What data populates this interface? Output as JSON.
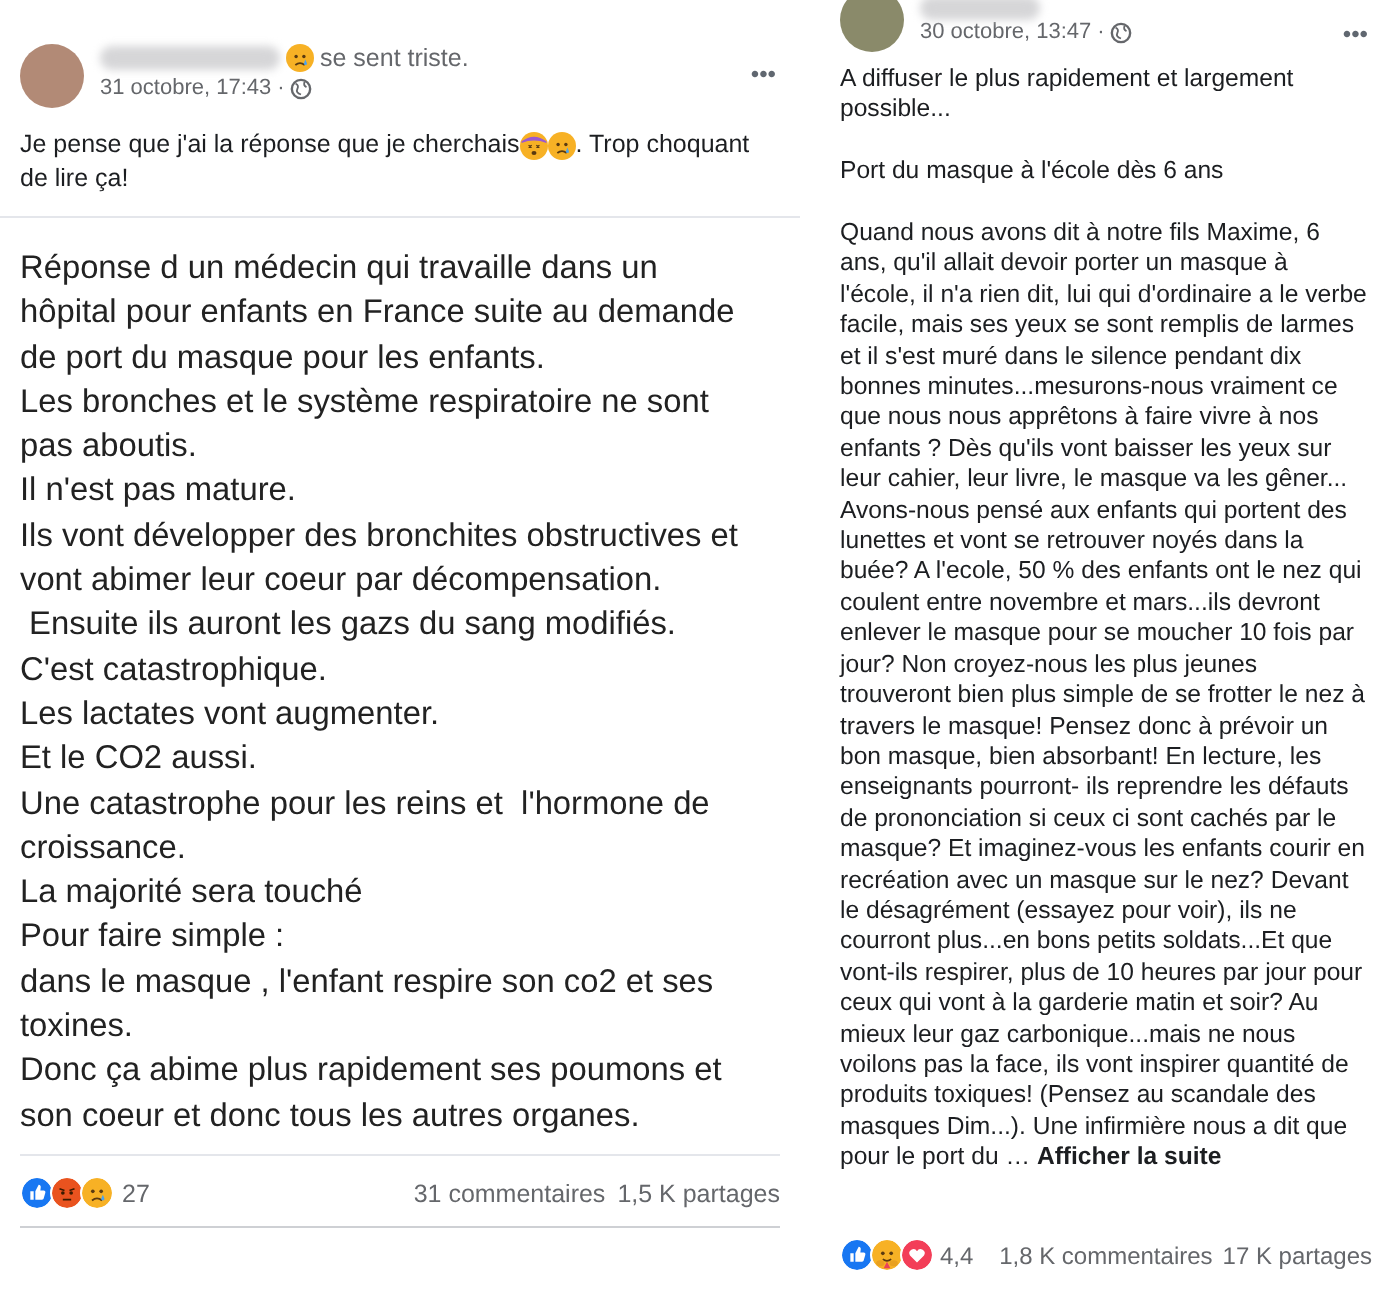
{
  "posts": [
    {
      "status": "se sent triste.",
      "time": "31 octobre, 17:43",
      "menu": "•••",
      "separator": "·",
      "caption_lines": [
        [
          "Je pense que j'ai la réponse que je cherchais",
          ". Trop choquant"
        ],
        [
          "de lire ça!"
        ]
      ],
      "image_lines": [
        "Réponse d un médecin qui travaille dans un",
        "hôpital pour enfants en France suite au demande",
        "de port du masque pour les enfants.",
        "Les bronches et le système respiratoire ne sont",
        "pas aboutis.",
        "Il n'est pas mature.",
        "Ils vont développer des bronchites obstructives et",
        "vont abimer leur coeur par décompensation.",
        " Ensuite ils auront les gazs du sang modifiés.",
        "C'est catastrophique.",
        "Les lactates vont augmenter.",
        "Et le CO2 aussi.",
        "Une catastrophe pour les reins et  l'hormone de",
        "croissance.",
        "La majorité sera touché",
        "Pour faire simple :",
        "dans le masque , l'enfant respire son co2 et ses",
        "toxines.",
        "Donc ça abime plus rapidement ses poumons et",
        "son coeur et donc tous les autres organes."
      ],
      "reactions": [
        {
          "kind": "like"
        },
        {
          "kind": "angry"
        },
        {
          "kind": "sad"
        }
      ],
      "reaction_count": "27",
      "comments": "31 commentaires",
      "shares": "1,5 K partages"
    },
    {
      "time": "30 octobre, 13:47",
      "separator": "·",
      "menu": "•••",
      "paragraphs": [
        "A diffuser le plus rapidement et largement possible...",
        "Port du masque à l'école dès 6 ans",
        "Quand nous avons dit à notre fils Maxime, 6 ans, qu'il allait devoir porter un masque à l'école, il n'a rien dit, lui qui d'ordinaire a le verbe facile, mais ses yeux se sont remplis de larmes et il s'est muré dans le silence pendant dix bonnes minutes...mesurons-nous vraiment ce que nous nous apprêtons à faire vivre à nos enfants ? Dès qu'ils vont baisser les yeux sur leur cahier, leur livre, le masque va les gêner... Avons-nous pensé aux enfants qui portent des lunettes et vont se retrouver noyés dans la buée? A l'ecole, 50 % des enfants ont le nez qui coulent entre novembre et mars...ils devront enlever le masque pour se moucher 10 fois par jour? Non croyez-nous les plus jeunes trouveront bien plus simple de se frotter le nez à travers le masque! Pensez donc à prévoir un bon masque, bien absorbant! En lecture, les enseignants pourront- ils reprendre les défauts de prononciation si ceux ci sont cachés par le masque? Et imaginez-vous les enfants courir en recréation avec un masque sur le nez? Devant le désagrément (essayez pour voir), ils ne courront plus...en bons petits soldats...Et que vont-ils respirer, plus de 10 heures par jour pour ceux qui vont à la garderie matin et soir? Au mieux leur gaz carbonique...mais ne nous voilons pas la face, ils vont inspirer quantité de produits toxiques! (Pensez au scandale des masques Dim...). Une infirmière nous a dit que pour le port du …"
      ],
      "see_more": "Afficher la suite",
      "reactions": [
        {
          "kind": "like"
        },
        {
          "kind": "care"
        },
        {
          "kind": "love"
        }
      ],
      "reaction_count": "4,4",
      "comments": "1,8 K commentaires",
      "shares": "17 K partages"
    }
  ]
}
